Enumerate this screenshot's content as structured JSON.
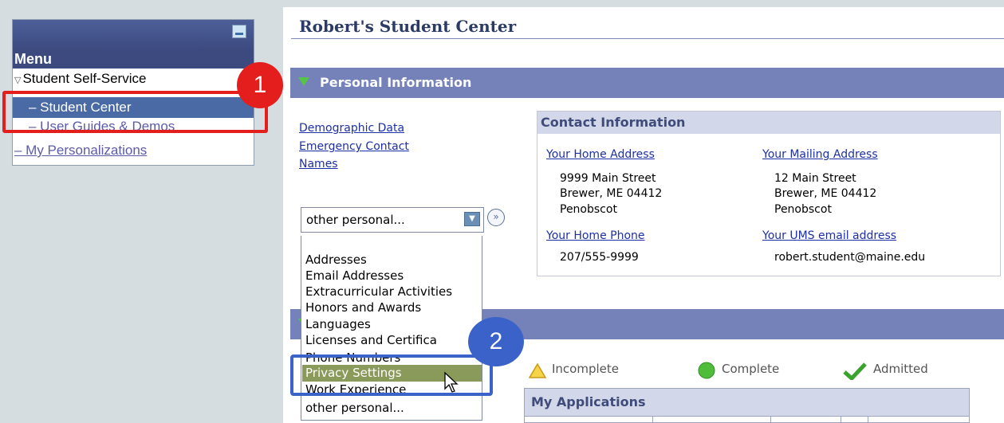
{
  "app": {
    "page_title": "Robert's Student Center"
  },
  "menu": {
    "title": "Menu",
    "items": [
      {
        "label": "Student Self-Service"
      },
      {
        "label": "– Student Center"
      },
      {
        "label": "– User Guides & Demos"
      },
      {
        "label": "– My Personalizations"
      }
    ]
  },
  "callouts": {
    "first": "1",
    "second": "2"
  },
  "personal_info": {
    "section_title": "Personal Information",
    "links": [
      "Demographic Data",
      "Emergency Contact",
      "Names"
    ],
    "contact": {
      "header": "Contact Information",
      "home_address_label": "Your Home Address",
      "home_address": [
        "9999 Main Street",
        "Brewer, ME 04412",
        "Penobscot"
      ],
      "mailing_address_label": "Your Mailing Address",
      "mailing_address": [
        "12 Main Street",
        "Brewer, ME 04412",
        "Penobscot"
      ],
      "home_phone_label": "Your Home Phone",
      "home_phone": "207/555-9999",
      "email_label": "Your UMS email address",
      "email": "robert.student@maine.edu"
    },
    "select": {
      "value": "other personal...",
      "options": [
        "Addresses",
        "Email Addresses",
        "Extracurricular Activities",
        "Honors and Awards",
        "Languages",
        "Licenses and Certifica",
        "Phone Numbers",
        "Privacy Settings",
        "Work Experience",
        "other personal..."
      ],
      "highlighted": "Privacy Settings"
    }
  },
  "status_legend": {
    "incomplete": "Incomplete",
    "complete": "Complete",
    "admitted": "Admitted"
  },
  "applications": {
    "header": "My Applications"
  },
  "colors": {
    "section_bar": "#7482b9",
    "menu_selected": "#4a6aa5",
    "callout_red": "#e41d1d",
    "callout_blue": "#3a62c8"
  }
}
